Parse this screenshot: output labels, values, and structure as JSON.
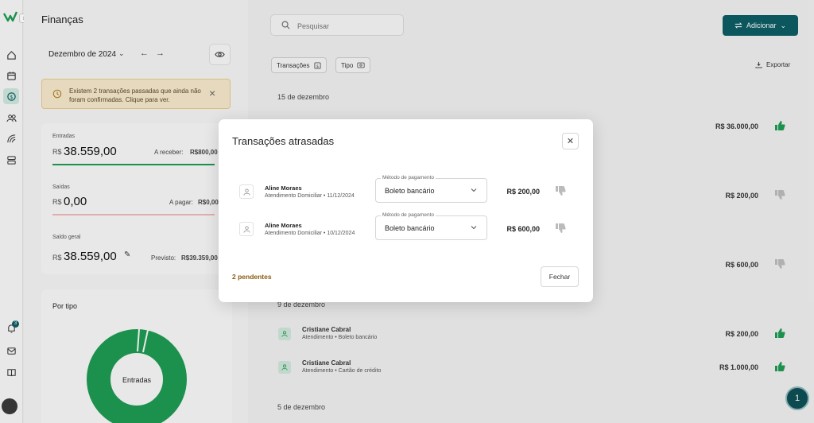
{
  "left": {
    "title": "Finanças",
    "month": "Dezembro de 2024",
    "alert": "Existem 2 transações passadas que ainda não foram confirmadas. Clique para ver.",
    "currency": "R$",
    "entradas_label": "Entradas",
    "entradas_value": "38.559,00",
    "a_receber_label": "A receber:",
    "a_receber_value": "R$800,00",
    "saidas_label": "Saídas",
    "saidas_value": "0,00",
    "a_pagar_label": "A pagar:",
    "a_pagar_value": "R$0,00",
    "saldo_label": "Saldo geral",
    "saldo_value": "38.559,00",
    "previsto_label": "Previsto:",
    "previsto_value": "R$39.359,00",
    "por_tipo_title": "Por tipo",
    "donut_label": "Entradas"
  },
  "main": {
    "search_placeholder": "Pesquisar",
    "add_label": "Adicionar",
    "filter_transacoes": "Transações",
    "filter_tipo": "Tipo",
    "export_label": "Exportar",
    "date_15": "15 de dezembro",
    "date_9": "9 de dezembro",
    "date_5": "5 de dezembro",
    "amounts_bg": [
      "R$ 36.000,00",
      "R$ 200,00",
      "R$ 600,00"
    ],
    "transactions": [
      {
        "name": "Cristiane Cabral",
        "desc": "Atendimento • Boleto bancário",
        "amount": "R$ 200,00"
      },
      {
        "name": "Cristiane Cabral",
        "desc": "Atendimento • Cartão de crédito",
        "amount": "R$ 1.000,00"
      }
    ],
    "chat_count": "1",
    "notif_count": "3"
  },
  "modal": {
    "title": "Transações atrasadas",
    "field_label": "Método de pagamento",
    "rows": [
      {
        "name": "Aline Moraes",
        "desc": "Atendimento Domiciliar • 11/12/2024",
        "method": "Boleto bancário",
        "amount": "R$ 200,00"
      },
      {
        "name": "Aline Moraes",
        "desc": "Atendimento Domiciliar • 10/12/2024",
        "method": "Boleto bancário",
        "amount": "R$ 600,00"
      }
    ],
    "pending": "2 pendentes",
    "close_label": "Fechar"
  },
  "colors": {
    "brand": "#0d5c63",
    "green": "#1e9b52",
    "alert_bg": "#f6e7c9",
    "pending": "#8a5a10"
  },
  "icons": [
    "logo-icon",
    "home-icon",
    "calendar-icon",
    "finance-icon",
    "users-icon",
    "reports-icon",
    "database-icon",
    "bell-icon",
    "mail-icon",
    "book-icon",
    "search-icon",
    "swap-icon",
    "download-icon",
    "thumbs-up-icon",
    "thumbs-down-icon",
    "eye-icon",
    "clock-icon",
    "user-icon",
    "chevron-down-icon",
    "close-icon",
    "pencil-icon"
  ]
}
